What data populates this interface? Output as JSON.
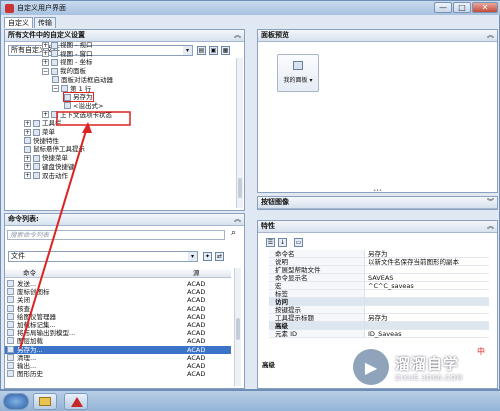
{
  "window": {
    "title": "自定义用户界面",
    "btn_min": "—",
    "btn_max": "□",
    "btn_close": "✕"
  },
  "tabs": [
    {
      "label": "自定义"
    },
    {
      "label": "传输"
    }
  ],
  "custom_panel": {
    "title": "所有文件中的自定义设置",
    "collapse": "︽",
    "file_combo": "所有自定义文件",
    "tree": [
      {
        "label": "视图 - 视口",
        "exp": "+"
      },
      {
        "label": "视图 - 窗口",
        "exp": "+"
      },
      {
        "label": "视图 - 坐标",
        "exp": "+"
      },
      {
        "label": "我的面板",
        "exp": "−"
      },
      {
        "label": "面板对话框启动器",
        "exp": ""
      },
      {
        "label": "第 1 行",
        "exp": "−"
      },
      {
        "label": "另存为",
        "exp": ""
      },
      {
        "label": "<溢出式>",
        "exp": ""
      },
      {
        "label": "上下文选项卡状态",
        "exp": "+"
      },
      {
        "label": "工具栏",
        "exp": "+"
      },
      {
        "label": "菜单",
        "exp": "+"
      },
      {
        "label": "快捷特性",
        "exp": ""
      },
      {
        "label": "鼠标悬停工具提示",
        "exp": ""
      },
      {
        "label": "快捷菜单",
        "exp": "+"
      },
      {
        "label": "键盘快捷键",
        "exp": "+"
      },
      {
        "label": "双击动作",
        "exp": "+"
      }
    ]
  },
  "commands_panel": {
    "title": "命令列表:",
    "collapse": "︽",
    "search_placeholder": "搜索命令列表",
    "filter_combo": "文件",
    "col_command": "命令",
    "col_source": "源",
    "rows": [
      {
        "name": "发送...",
        "src": "ACAD"
      },
      {
        "name": "废标创图标",
        "src": "ACAD"
      },
      {
        "name": "关闭",
        "src": "ACAD"
      },
      {
        "name": "核查",
        "src": "ACAD"
      },
      {
        "name": "绘图仪管理器",
        "src": "ACAD"
      },
      {
        "name": "加载标记集...",
        "src": "ACAD"
      },
      {
        "name": "将布局输出到模型...",
        "src": "ACAD"
      },
      {
        "name": "图层加载",
        "src": "ACAD"
      },
      {
        "name": "另存为...",
        "src": "ACAD"
      },
      {
        "name": "清理...",
        "src": "ACAD"
      },
      {
        "name": "输出...",
        "src": "ACAD"
      },
      {
        "name": "图形历史",
        "src": "ACAD"
      }
    ]
  },
  "preview_panel": {
    "title": "面板预览",
    "collapse": "︽",
    "group_label": "我的面板 ▾",
    "button_label": "另存为"
  },
  "button_image_panel": {
    "title": "按钮图像",
    "collapse": "︾"
  },
  "properties_panel": {
    "title": "特性",
    "collapse": "︽",
    "rows": [
      {
        "k": "命令名",
        "v": "另存为",
        "cat": false
      },
      {
        "k": "说明",
        "v": "以新文件名保存当前图形的副本",
        "cat": false
      },
      {
        "k": "扩展型帮助文件",
        "v": "",
        "cat": false
      },
      {
        "k": "命令显示名",
        "v": "SAVEAS",
        "cat": false
      },
      {
        "k": "宏",
        "v": "^C^C_saveas",
        "cat": false
      },
      {
        "k": "标签",
        "v": "",
        "cat": false
      },
      {
        "k": "访问",
        "v": "",
        "cat": true
      },
      {
        "k": "按键提示",
        "v": "",
        "cat": false
      },
      {
        "k": "工具提示标题",
        "v": "另存为",
        "cat": false
      },
      {
        "k": "高级",
        "v": "",
        "cat": true
      },
      {
        "k": "元素 ID",
        "v": "ID_Saveas",
        "cat": false
      }
    ],
    "footer": "高级"
  },
  "watermark": {
    "cn": "溜溜自学",
    "url": "ZIXUE.3D66.COM"
  },
  "ime": "中",
  "colors": {
    "accent": "#3a73c8",
    "callout": "#dd2222"
  }
}
